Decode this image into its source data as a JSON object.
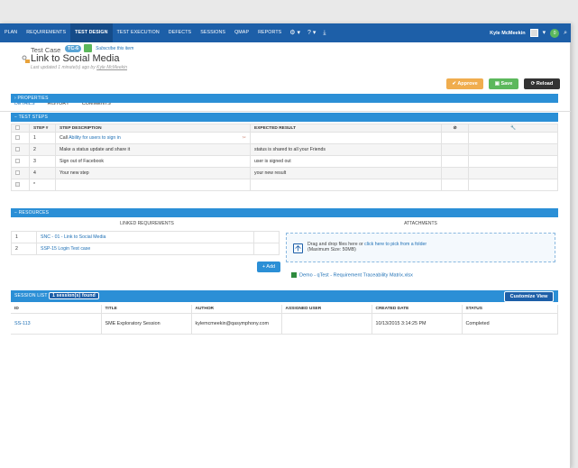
{
  "nav": {
    "items": [
      "PLAN",
      "REQUIREMENTS",
      "TEST DESIGN",
      "TEST EXECUTION",
      "DEFECTS",
      "SESSIONS",
      "QMAP",
      "REPORTS"
    ],
    "active": "TEST DESIGN",
    "user_name": "Kyle McMeekin",
    "notification_count": "0"
  },
  "header": {
    "item_type": "Test Case",
    "item_id": "TC-6",
    "subscribe_label": "Subscribe this item",
    "title": "Link to Social Media",
    "updated_prefix": "Last updated 1 minute(s) ago by",
    "updated_user": "Kyle McMeekin",
    "approve_label": "Approve",
    "save_label": "Save",
    "reload_label": "Reload"
  },
  "tabs": [
    "DETAILS",
    "HISTORY",
    "COMMENTS"
  ],
  "properties_label": "PROPERTIES",
  "steps": {
    "label": "TEST STEPS",
    "headers": {
      "step": "STEP #",
      "description": "STEP DESCRIPTION",
      "expected": "EXPECTED RESULT"
    },
    "rows": [
      {
        "num": "1",
        "call_prefix": "Call",
        "description": "Ability for users to sign in",
        "expected": ""
      },
      {
        "num": "2",
        "description": "Make a status update and share it",
        "expected": "status is shared to all your Friends"
      },
      {
        "num": "3",
        "description": "Sign out of Facebook",
        "expected": "user is signed out"
      },
      {
        "num": "4",
        "description": "Your new step",
        "expected": "your new result"
      },
      {
        "num": "*",
        "description": "",
        "expected": ""
      }
    ]
  },
  "resources": {
    "label": "RESOURCES",
    "linked_header": "LINKED REQUIREMENTS",
    "attachments_header": "ATTACHMENTS",
    "requirements": [
      {
        "num": "1",
        "name": "SNC - 01 - Link to Social Media"
      },
      {
        "num": "2",
        "name": "SSP-15 Login Test case"
      }
    ],
    "add_label": "+ Add",
    "dropzone_text": "Drag and drop files here or",
    "dropzone_link": "click here to pick from a folder",
    "dropzone_max": "(Maximum Size: 50MB)",
    "attachment_name": "Demo - qTest - Requirement Traceability Matrix.xlsx"
  },
  "sessions": {
    "label": "SESSION LIST",
    "count_badge": "1 session(s) found",
    "customize_label": "Customize View",
    "headers": [
      "ID",
      "TITLE",
      "AUTHOR",
      "ASSIGNED USER",
      "CREATED DATE",
      "STATUS"
    ],
    "rows": [
      {
        "id": "SS-113",
        "title": "SME Exploratory Session",
        "author": "kylemcmeekin@qasymphony.com",
        "assigned": "",
        "created": "10/13/2015 3:14:25 PM",
        "status": "Completed"
      }
    ]
  },
  "colors": {
    "nav": "#1d5fa8",
    "section": "#2b8fd6",
    "approve": "#f0ad4e",
    "save": "#5cb85c",
    "reload": "#333333"
  }
}
